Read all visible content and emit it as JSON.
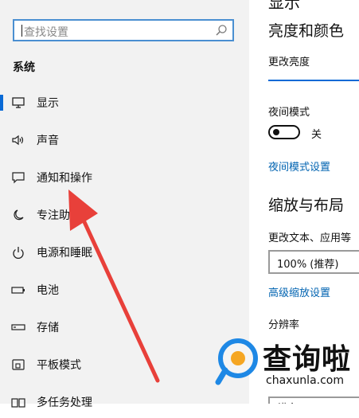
{
  "search": {
    "placeholder": "查找设置"
  },
  "sidebar": {
    "section_title": "系统",
    "items": [
      {
        "label": "显示",
        "icon": "monitor-icon",
        "active": true
      },
      {
        "label": "声音",
        "icon": "speaker-icon"
      },
      {
        "label": "通知和操作",
        "icon": "notification-icon"
      },
      {
        "label": "专注助手",
        "icon": "moon-icon"
      },
      {
        "label": "电源和睡眠",
        "icon": "power-icon"
      },
      {
        "label": "电池",
        "icon": "battery-icon"
      },
      {
        "label": "存储",
        "icon": "storage-icon"
      },
      {
        "label": "平板模式",
        "icon": "tablet-icon"
      },
      {
        "label": "多任务处理",
        "icon": "multitask-icon"
      }
    ]
  },
  "content": {
    "page_title": "显示",
    "brightness_heading": "亮度和颜色",
    "brightness_label": "更改亮度",
    "night_mode_label": "夜间模式",
    "night_mode_state": "关",
    "night_mode_settings_link": "夜间模式设置",
    "scale_heading": "缩放与布局",
    "scale_label": "更改文本、应用等",
    "scale_value": "100% (推荐)",
    "advanced_scale_link": "高级缩放设置",
    "resolution_label": "分辨率",
    "orientation_value": "横向"
  },
  "watermark": {
    "text": "查询啦",
    "url": "chaxunla.com"
  },
  "colors": {
    "accent": "#0a6ad6",
    "arrow": "#e8403a",
    "link": "#0063b1"
  }
}
